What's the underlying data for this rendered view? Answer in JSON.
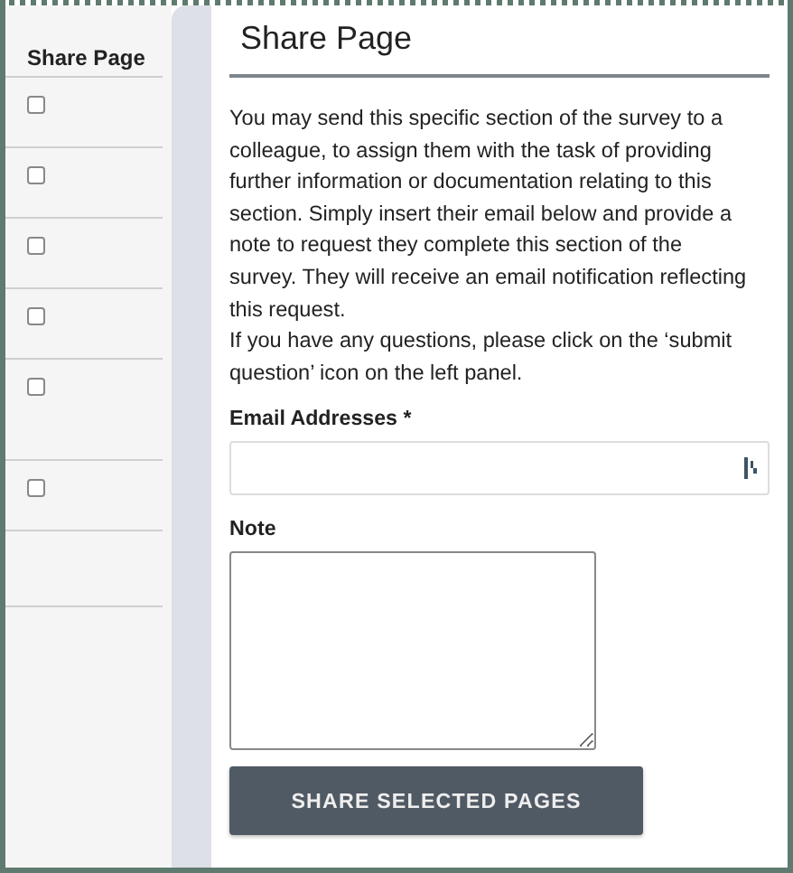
{
  "sidebar": {
    "header": "Share Page",
    "rows": [
      {
        "kind": "checkbox",
        "checked": false
      },
      {
        "kind": "checkbox",
        "checked": false
      },
      {
        "kind": "checkbox",
        "checked": false
      },
      {
        "kind": "checkbox",
        "checked": false
      },
      {
        "kind": "checkbox",
        "checked": false,
        "tall": true
      },
      {
        "kind": "checkbox",
        "checked": false
      },
      {
        "kind": "empty"
      }
    ]
  },
  "panel": {
    "title": "Share Page",
    "description": [
      "You may send this specific section of the survey to a colleague, to assign them with the task of providing further information or documentation relating to this section. Simply insert their email below and provide a note to request they complete this section of the survey. They will receive an email notification reflecting this request.",
      "If you have any questions, please click on the ‘submit question’ icon on the left panel."
    ],
    "email_label": "Email Addresses *",
    "note_label": "Note",
    "button": "SHARE SELECTED PAGES"
  }
}
